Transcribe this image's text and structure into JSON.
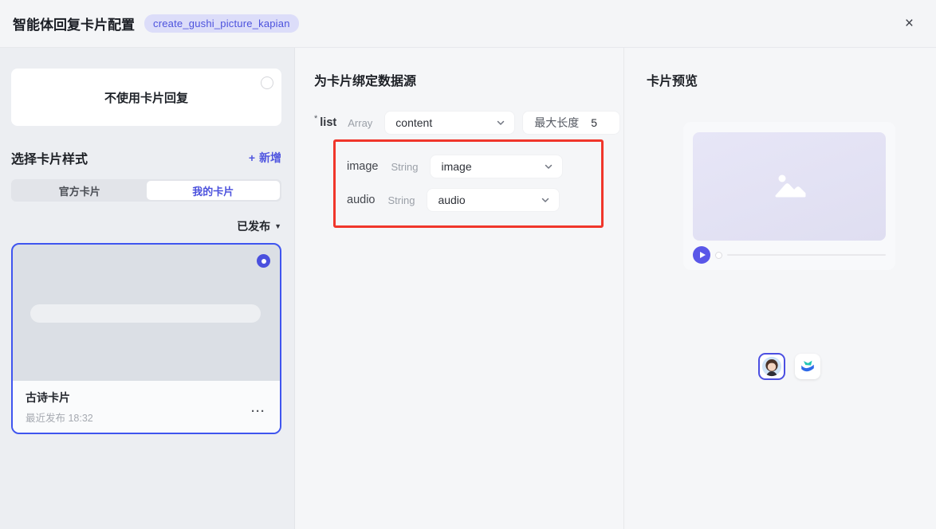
{
  "colors": {
    "accent": "#4c52dd",
    "highlight_red": "#f0362b",
    "card_border_blue": "#3f55ef"
  },
  "icons": {
    "close": "×",
    "plus": "+",
    "caret_down": "▼",
    "more": "···"
  },
  "header": {
    "title": "智能体回复卡片配置",
    "badge": "create_gushi_picture_kapian"
  },
  "left": {
    "no_card_label": "不使用卡片回复",
    "section_title": "选择卡片样式",
    "add_label": "新增",
    "tabs": [
      {
        "label": "官方卡片"
      },
      {
        "label": "我的卡片"
      }
    ],
    "filter_label": "已发布",
    "card": {
      "title": "古诗卡片",
      "subtitle": "最近发布 18:32"
    }
  },
  "main": {
    "title": "为卡片绑定数据源",
    "fields": [
      {
        "required": "*",
        "name": "list",
        "type": "Array",
        "value": "content",
        "max_label": "最大长度",
        "max_value": "5"
      },
      {
        "name": "image",
        "type": "String",
        "value": "image"
      },
      {
        "name": "audio",
        "type": "String",
        "value": "audio"
      }
    ]
  },
  "preview": {
    "title": "卡片预览"
  }
}
